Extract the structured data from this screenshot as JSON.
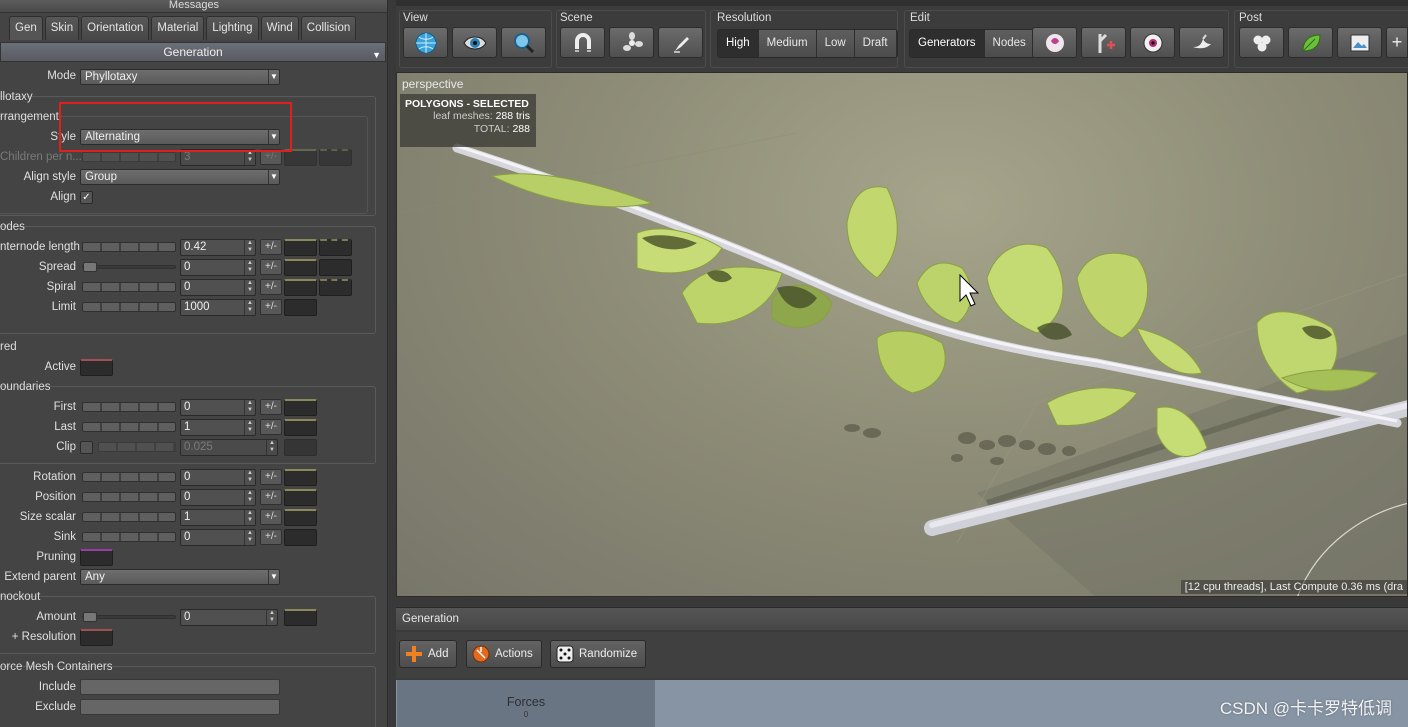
{
  "left_panel": {
    "messages_title": "Messages",
    "tabs": [
      "Gen",
      "Skin",
      "Orientation",
      "Material",
      "Lighting",
      "Wind",
      "Collision"
    ],
    "section_title": "Generation",
    "mode": {
      "label": "Mode",
      "value": "Phyllotaxy"
    },
    "phyllotaxy": {
      "group_label": "llotaxy",
      "arrangement_label": "rrangement",
      "style": {
        "label": "Style",
        "value": "Alternating"
      },
      "children_per": {
        "label": "Children per n...",
        "value": "3"
      },
      "align_style": {
        "label": "Align style",
        "value": "Group"
      },
      "align": {
        "label": "Align",
        "checked": "✓"
      }
    },
    "nodes": {
      "group_label": "odes",
      "internode_length": {
        "label": "nternode length",
        "value": "0.42"
      },
      "spread": {
        "label": "Spread",
        "value": "0"
      },
      "spiral": {
        "label": "Spiral",
        "value": "0"
      },
      "limit": {
        "label": "Limit",
        "value": "1000"
      }
    },
    "red": {
      "group_label": "red",
      "active_label": "Active"
    },
    "boundaries": {
      "group_label": "oundaries",
      "first": {
        "label": "First",
        "value": "0"
      },
      "last": {
        "label": "Last",
        "value": "1"
      },
      "clip": {
        "label": "Clip",
        "value": "0.025"
      }
    },
    "transform": {
      "rotation": {
        "label": "Rotation",
        "value": "0"
      },
      "position": {
        "label": "Position",
        "value": "0"
      },
      "size_scalar": {
        "label": "Size scalar",
        "value": "1"
      },
      "sink": {
        "label": "Sink",
        "value": "0"
      },
      "pruning_label": "Pruning",
      "extend_parent": {
        "label": "Extend parent",
        "value": "Any"
      }
    },
    "knockout": {
      "group_label": "nockout",
      "amount": {
        "label": "Amount",
        "value": "0"
      },
      "resolution_label": "+ Resolution"
    },
    "force_mesh": {
      "group_label": "orce Mesh Containers",
      "include_label": "Include",
      "exclude_label": "Exclude"
    },
    "pm_label": "+/-"
  },
  "toolbar": {
    "view_label": "View",
    "scene_label": "Scene",
    "resolution_label": "Resolution",
    "resolution_options": [
      "High",
      "Medium",
      "Low",
      "Draft"
    ],
    "resolution_selected": "High",
    "edit_label": "Edit",
    "edit_options": [
      "Generators",
      "Nodes"
    ],
    "edit_selected": "Generators",
    "post_label": "Post"
  },
  "viewport": {
    "camera_label": "perspective",
    "polygons_title": "POLYGONS - SELECTED",
    "leaf_meshes_label": "leaf meshes:",
    "leaf_meshes_value": "288 tris",
    "total_label": "TOTAL:",
    "total_value": "288",
    "status": "[12 cpu threads], Last Compute 0.36 ms (dra"
  },
  "bottom_panel": {
    "title": "Generation",
    "buttons": {
      "add": "Add",
      "actions": "Actions",
      "randomize": "Randomize"
    },
    "node_title": "Forces",
    "node_sub": "0"
  },
  "watermark": "CSDN @卡卡罗特低调",
  "colors": {
    "highlight_box": "#e0201c",
    "leaf": "#b9d36a",
    "branch": "#e3e3e3",
    "node_area": "#8794a4"
  }
}
